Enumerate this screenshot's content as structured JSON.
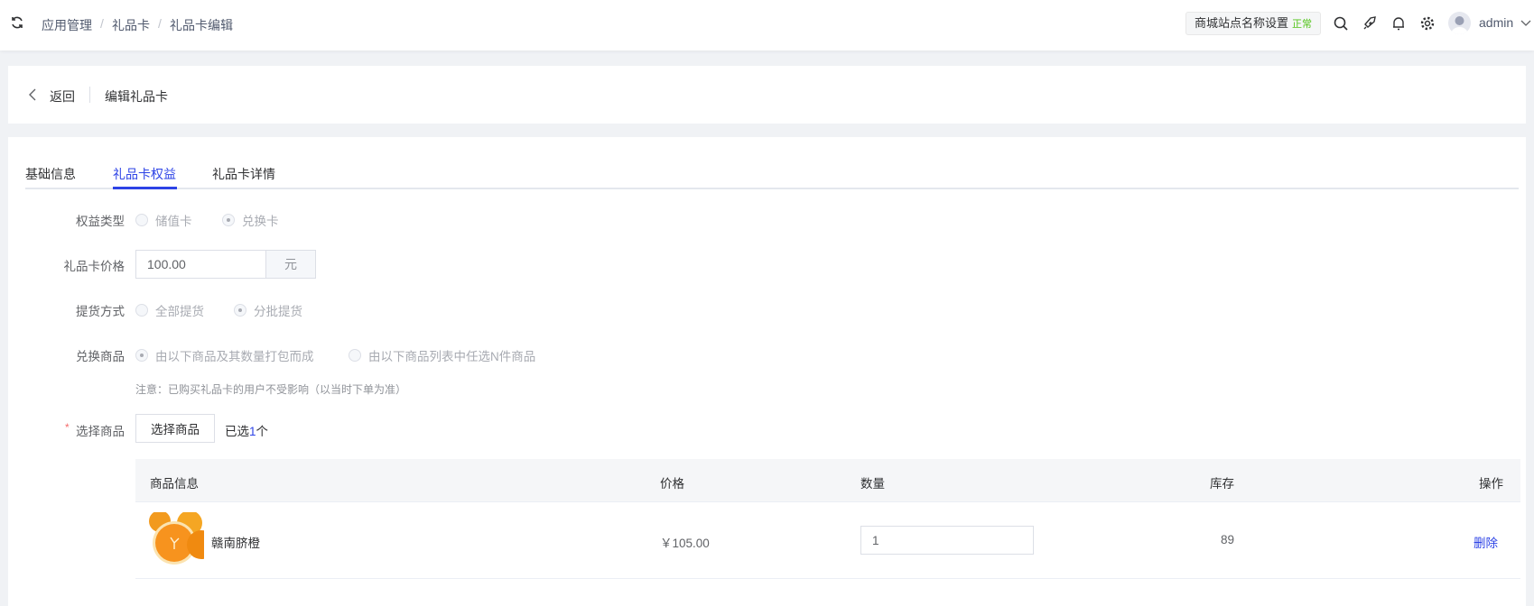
{
  "header": {
    "breadcrumb": [
      "应用管理",
      "礼品卡",
      "礼品卡编辑"
    ],
    "separator": "/",
    "site_name": "商城站点名称设置",
    "site_status": "正常",
    "user": "admin",
    "status_color": "#52c41a"
  },
  "page_header": {
    "back": "返回",
    "title": "编辑礼品卡"
  },
  "tabs": [
    {
      "label": "基础信息"
    },
    {
      "label": "礼品卡权益",
      "active": true
    },
    {
      "label": "礼品卡详情"
    }
  ],
  "form": {
    "benefit_type": {
      "label": "权益类型",
      "options": [
        "储值卡",
        "兑换卡"
      ],
      "selected": "兑换卡"
    },
    "price": {
      "label": "礼品卡价格",
      "value": "100.00",
      "unit": "元"
    },
    "delivery": {
      "label": "提货方式",
      "options": [
        "全部提货",
        "分批提货"
      ],
      "selected": "分批提货"
    },
    "exchange": {
      "label": "兑换商品",
      "options": [
        "由以下商品及其数量打包而成",
        "由以下商品列表中任选N件商品"
      ],
      "selected": "由以下商品及其数量打包而成",
      "note": "注意：已购买礼品卡的用户不受影响（以当时下单为准）"
    },
    "select": {
      "required": "*",
      "label": "选择商品",
      "button": "选择商品",
      "selected_prefix": "已选",
      "selected_count": "1",
      "selected_suffix": "个"
    }
  },
  "table": {
    "headers": [
      "商品信息",
      "价格",
      "数量",
      "库存",
      "操作"
    ],
    "rows": [
      {
        "name": "赣南脐橙",
        "price": "￥105.00",
        "quantity": "1",
        "stock": "89",
        "action": "删除"
      }
    ]
  },
  "accent": "#2d43e6"
}
